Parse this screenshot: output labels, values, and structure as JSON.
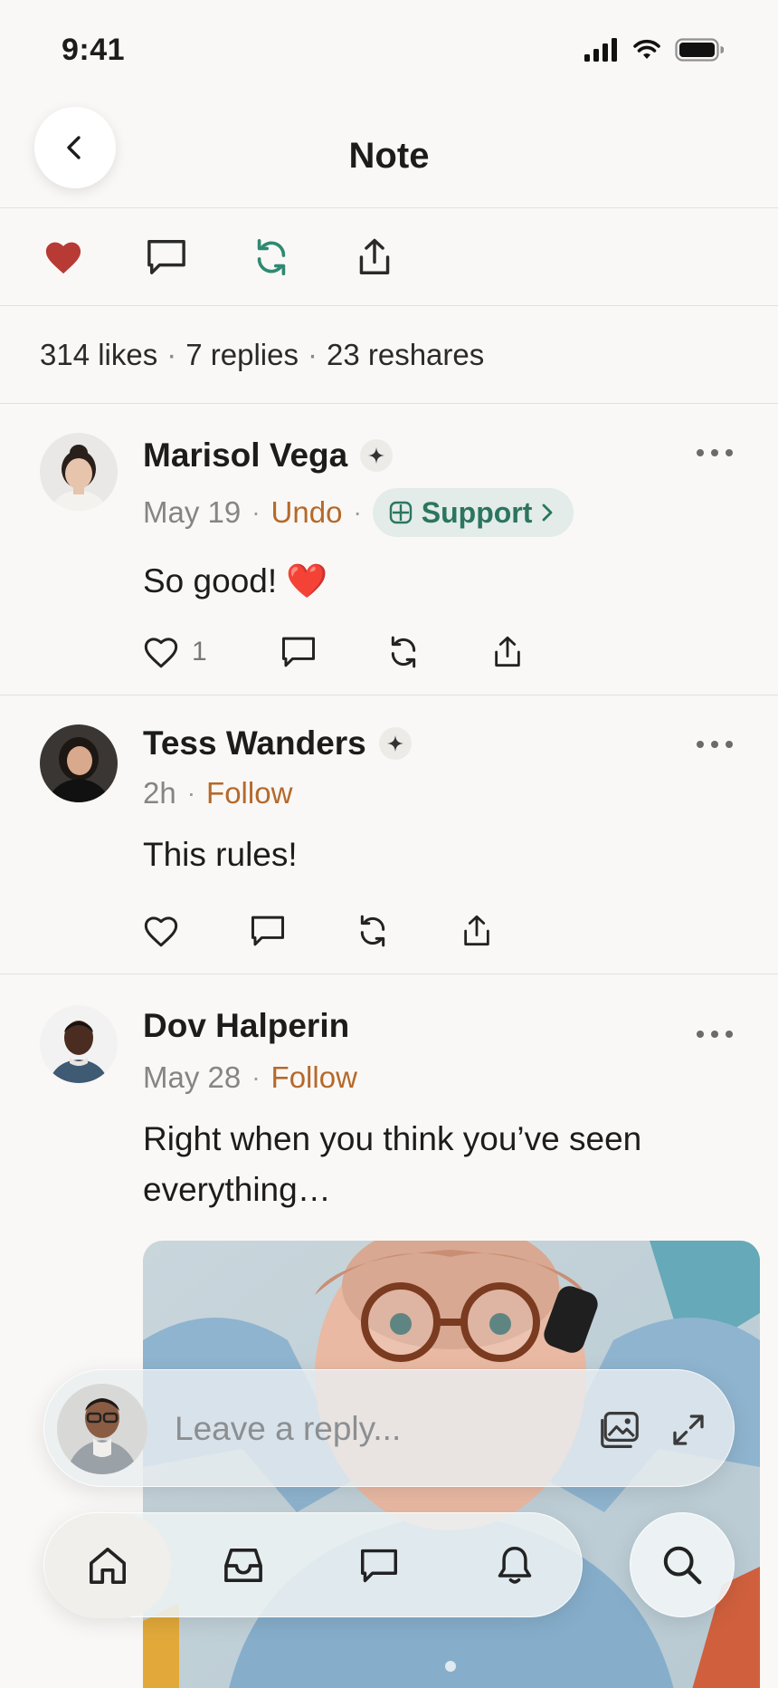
{
  "status_bar": {
    "time": "9:41"
  },
  "header": {
    "title": "Note"
  },
  "stats": {
    "likes": "314 likes",
    "replies": "7 replies",
    "reshares": "23 reshares"
  },
  "replies": [
    {
      "name": "Marisol Vega",
      "date": "May 19",
      "action": "Undo",
      "support_label": "Support",
      "text": "So good! ❤️",
      "like_count": "1"
    },
    {
      "name": "Tess Wanders",
      "date": "2h",
      "action": "Follow",
      "text": "This rules!",
      "like_count": ""
    },
    {
      "name": "Dov Halperin",
      "date": "May 28",
      "action": "Follow",
      "text": "Right when you think you’ve seen everything…",
      "like_count": ""
    }
  ],
  "composer": {
    "placeholder": "Leave a reply..."
  },
  "colors": {
    "like_active": "#b83a34",
    "reshare_active": "#2e8a72",
    "link": "#b5692b",
    "support_bg": "#e3ece8",
    "support_text": "#2c7560"
  },
  "icons": {
    "action_row": [
      "heart-filled-icon",
      "comment-icon",
      "reshare-icon",
      "share-icon"
    ],
    "tab_bar": [
      "home-icon",
      "inbox-icon",
      "messages-icon",
      "bell-icon"
    ],
    "search": "search-icon"
  }
}
